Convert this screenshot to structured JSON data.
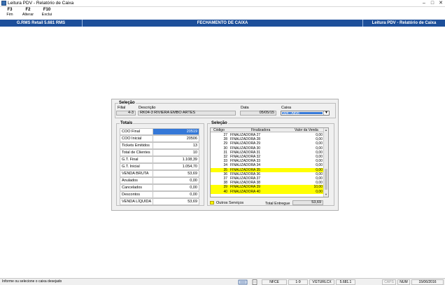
{
  "window": {
    "title": "Leitura PDV - Relatório de Caixa",
    "controls": [
      "minimize-icon",
      "maximize-icon",
      "close-icon"
    ]
  },
  "toolbar": [
    {
      "key": "F3",
      "label": "Fim"
    },
    {
      "key": "F2",
      "label": "Alterar"
    },
    {
      "key": "F10",
      "label": "Exclui"
    }
  ],
  "header_bar": {
    "left": "G.RMS Retail 5.681 RMS",
    "center": "FECHAMENTO DE CAIXA",
    "right": "Leitura PDV - Relatório de Caixa",
    "color": "#1d4f9a"
  },
  "selection_top": {
    "title": "Seleção",
    "filial_label": "Filial",
    "filial_value": "4-3",
    "descricao_label": "Descrição",
    "descricao_value": "RK04-3 RIVIERA EMBO ARTES",
    "data_label": "Data",
    "data_value": "05/05/15",
    "caixa_label": "Caixa",
    "caixa_value": "004 - Ativo"
  },
  "totals": {
    "title": "Totais",
    "rows": [
      {
        "label": "COO Final",
        "value": "20519",
        "highlight": true
      },
      {
        "label": "COO Inicial",
        "value": "20506"
      },
      {
        "label": "Tickets Emitidos",
        "value": "13"
      },
      {
        "label": "Total de Clientes",
        "value": "10"
      },
      {
        "label": "G.T. Final",
        "value": "1.108,39"
      },
      {
        "label": "G.T. Inicial",
        "value": "1.054,70"
      },
      {
        "label": "VENDA BRUTA",
        "value": "53,69"
      },
      {
        "label": "Anulados",
        "value": "0,00"
      },
      {
        "label": "Cancelados",
        "value": "0,00"
      },
      {
        "label": "Descontos",
        "value": "0,00"
      },
      {
        "label": "VENDA LÍQUIDA",
        "value": "53,69"
      }
    ]
  },
  "selection_list": {
    "title": "Seleção",
    "columns": [
      "Código",
      "Finalizadora",
      "Valor da Venda"
    ],
    "rows": [
      {
        "code": "27",
        "name": "FINALIZADORA 27",
        "value": "0,00"
      },
      {
        "code": "28",
        "name": "FINALIZADORA 28",
        "value": "0,00"
      },
      {
        "code": "29",
        "name": "FINALIZADORA 29",
        "value": "0,00"
      },
      {
        "code": "30",
        "name": "FINALIZADORA 30",
        "value": "0,00"
      },
      {
        "code": "31",
        "name": "FINALIZADORA 31",
        "value": "0,00"
      },
      {
        "code": "32",
        "name": "FINALIZADORA 32",
        "value": "0,00"
      },
      {
        "code": "33",
        "name": "FINALIZADORA 33",
        "value": "0,00"
      },
      {
        "code": "34",
        "name": "FINALIZADORA 34",
        "value": "0,00"
      },
      {
        "code": "35",
        "name": "FINALIZADORA 35",
        "value": "0,00",
        "highlight": true
      },
      {
        "code": "36",
        "name": "FINALIZADORA 36",
        "value": "0,00"
      },
      {
        "code": "37",
        "name": "FINALIZADORA 37",
        "value": "0,00"
      },
      {
        "code": "38",
        "name": "FINALIZADORA 38",
        "value": "0,00"
      },
      {
        "code": "39",
        "name": "FINALIZADORA 39",
        "value": "10,00",
        "highlight": true
      },
      {
        "code": "40",
        "name": "FINALIZADORA 40",
        "value": "0,00",
        "highlight": true
      }
    ],
    "legend_label": "Outros Serviços",
    "legend_color": "#ffff00",
    "total_label": "Total Entregue",
    "total_value": "53,69"
  },
  "statusbar": {
    "message": "Informe ou selecione o caixa desejado",
    "cells": [
      "NFCE",
      "1-9",
      "VGTURLCX",
      "5.681.1",
      "CAPS",
      "NUM",
      "15/06/2016"
    ]
  }
}
